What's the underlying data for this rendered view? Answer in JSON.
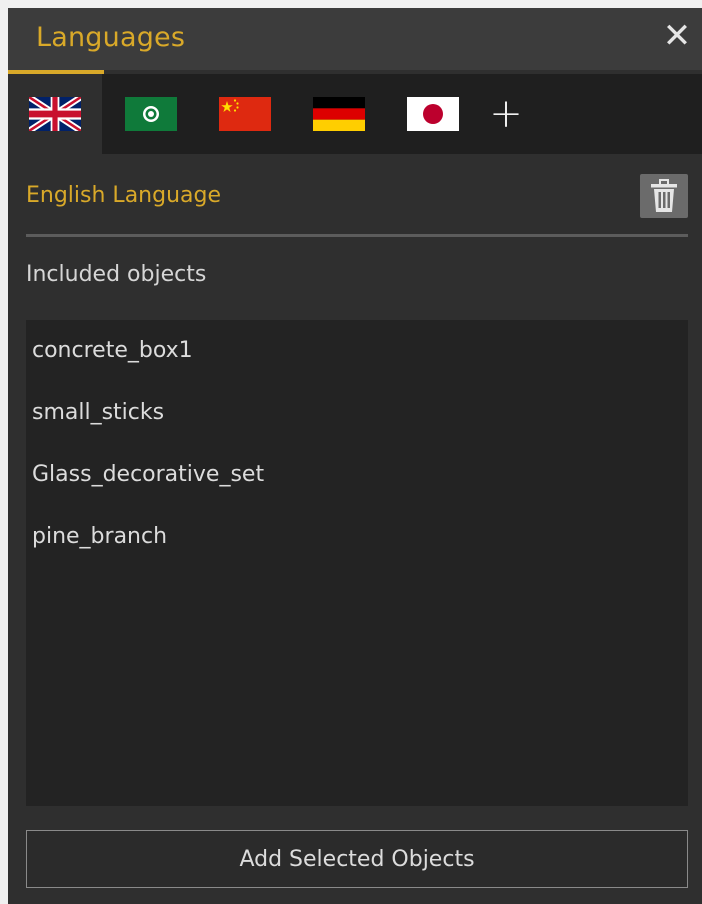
{
  "window": {
    "title": "Languages",
    "close_icon": "close-icon"
  },
  "tabs": [
    {
      "flag": "uk-flag",
      "active": true
    },
    {
      "flag": "arabic-flag",
      "active": false
    },
    {
      "flag": "china-flag",
      "active": false
    },
    {
      "flag": "germany-flag",
      "active": false
    },
    {
      "flag": "japan-flag",
      "active": false
    }
  ],
  "add_tab_label": "+",
  "language": {
    "name": "English Language",
    "delete_icon": "trash-icon"
  },
  "objects": {
    "label": "Included objects",
    "items": [
      "concrete_box1",
      "small_sticks",
      "Glass_decorative_set",
      "pine_branch"
    ]
  },
  "add_button_label": "Add Selected Objects",
  "colors": {
    "accent": "#d9a929",
    "panel": "#2f2f2f",
    "list_bg": "#232323"
  }
}
